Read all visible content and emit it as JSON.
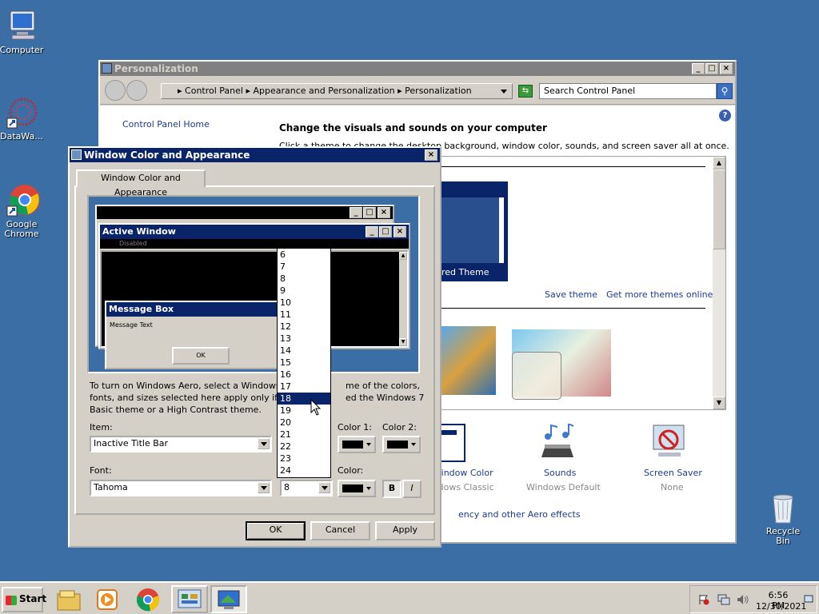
{
  "desktop": {
    "icons": [
      {
        "label": "Computer"
      },
      {
        "label": "DataWa..."
      },
      {
        "label": "Google Chrome"
      },
      {
        "label": "Recycle Bin"
      }
    ]
  },
  "personalization": {
    "title": "Personalization",
    "breadcrumb": [
      "Control Panel",
      "Appearance and Personalization",
      "Personalization"
    ],
    "search_placeholder": "Search Control Panel",
    "sidebar_home": "Control Panel Home",
    "heading": "Change the visuals and sounds on your computer",
    "subheading": "Click a theme to change the desktop background, window color, sounds, and screen saver all at once.",
    "theme_label": "red Theme",
    "save_theme": "Save theme",
    "more_themes": "Get more themes online",
    "bottom_items": [
      {
        "label": "Window Color",
        "sub": "Windows Classic"
      },
      {
        "label": "Sounds",
        "sub": "Windows Default"
      },
      {
        "label": "Screen Saver",
        "sub": "None"
      }
    ],
    "aero_link": "ency and other Aero effects"
  },
  "dialog": {
    "title": "Window Color and Appearance",
    "tab": "Window Color and Appearance",
    "preview": {
      "active_window": "Active Window",
      "disabled": "Disabled",
      "message_box": "Message Box",
      "message_text": "Message Text",
      "ok": "OK"
    },
    "info_text_1": "To turn on Windows Aero, select a Windows",
    "info_text_1b": "me of the colors,",
    "info_text_2": "fonts, and sizes selected here apply only if yo",
    "info_text_2b": "ed the Windows 7",
    "info_text_3": "Basic theme or a High Contrast theme.",
    "item_label": "Item:",
    "item_value": "Inactive Title Bar",
    "color1_label": "Color 1:",
    "color2_label": "Color 2:",
    "font_label": "Font:",
    "font_value": "Tahoma",
    "size_value": "8",
    "color_label": "Color:",
    "bold": "B",
    "italic": "I",
    "ok": "OK",
    "cancel": "Cancel",
    "apply": "Apply",
    "size_options": [
      "6",
      "7",
      "8",
      "9",
      "10",
      "11",
      "12",
      "13",
      "14",
      "15",
      "16",
      "17",
      "18",
      "19",
      "20",
      "21",
      "22",
      "23",
      "24"
    ],
    "size_highlighted": "18"
  },
  "taskbar": {
    "start": "Start",
    "time": "6:56 PM",
    "date": "12/30/2021"
  },
  "colors": {
    "desktop": "#3a6ea5",
    "title_active": "#0a246a",
    "face": "#d4d0c8"
  }
}
